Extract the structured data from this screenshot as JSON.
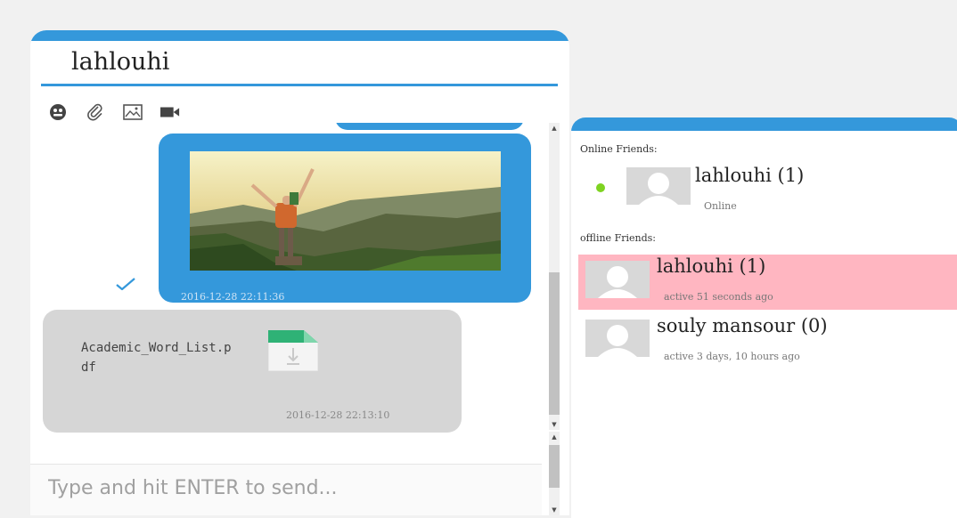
{
  "chat": {
    "title": "lahlouhi",
    "toolbar": [
      {
        "icon": "emoji-icon"
      },
      {
        "icon": "paperclip-icon"
      },
      {
        "icon": "image-icon"
      },
      {
        "icon": "video-icon"
      }
    ],
    "messages": [
      {
        "type": "image",
        "time": "2016-12-28 22:11:36",
        "read": true
      },
      {
        "type": "file",
        "file_name": "Academic_Word_List.pdf",
        "time": "2016-12-28 22:13:10"
      }
    ],
    "input": {
      "placeholder": "Type and hit ENTER to send...",
      "value": ""
    }
  },
  "friends": {
    "online_label": "Online Friends:",
    "offline_label": "offline Friends:",
    "online": [
      {
        "name": "lahlouhi (1)",
        "status": "Online"
      }
    ],
    "offline": [
      {
        "name": "lahlouhi (1)",
        "status": "active 51 seconds ago",
        "highlighted": true
      },
      {
        "name": "souly mansour (0)",
        "status": "active 3 days, 10 hours ago",
        "highlighted": false
      }
    ]
  },
  "colors": {
    "accent": "#3498db",
    "received_bubble": "#d6d6d6",
    "highlight_row": "#ffb6c1",
    "online_dot": "#7ed321"
  }
}
